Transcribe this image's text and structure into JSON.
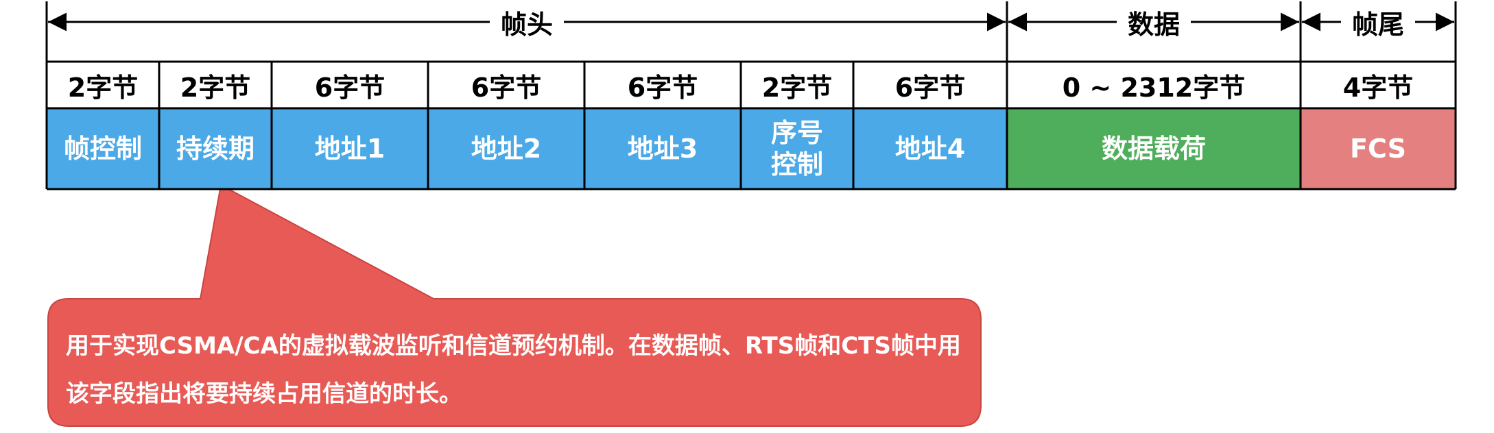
{
  "spans": [
    {
      "id": "header",
      "label": "帧头"
    },
    {
      "id": "data",
      "label": "数据"
    },
    {
      "id": "trailer",
      "label": "帧尾"
    }
  ],
  "fields": [
    {
      "size": "2字节",
      "name": "帧控制"
    },
    {
      "size": "2字节",
      "name": "持续期"
    },
    {
      "size": "6字节",
      "name": "地址1"
    },
    {
      "size": "6字节",
      "name": "地址2"
    },
    {
      "size": "6字节",
      "name": "地址3"
    },
    {
      "size": "2字节",
      "name": "序号\n控制"
    },
    {
      "size": "6字节",
      "name": "地址4"
    },
    {
      "size": "0 ~ 2312字节",
      "name": "数据载荷"
    },
    {
      "size": "4字节",
      "name": "FCS"
    }
  ],
  "callout": {
    "text": "用于实现CSMA/CA的虚拟载波监听和信道预约机制。在数据帧、RTS帧和CTS帧中用该字段指出将要持续占用信道的时长。"
  },
  "colors": {
    "header_fields": "#4aa9e6",
    "data_field": "#4fae5b",
    "fcs_field": "#e58080",
    "callout": "#e85a56",
    "callout_border": "#c94440"
  }
}
